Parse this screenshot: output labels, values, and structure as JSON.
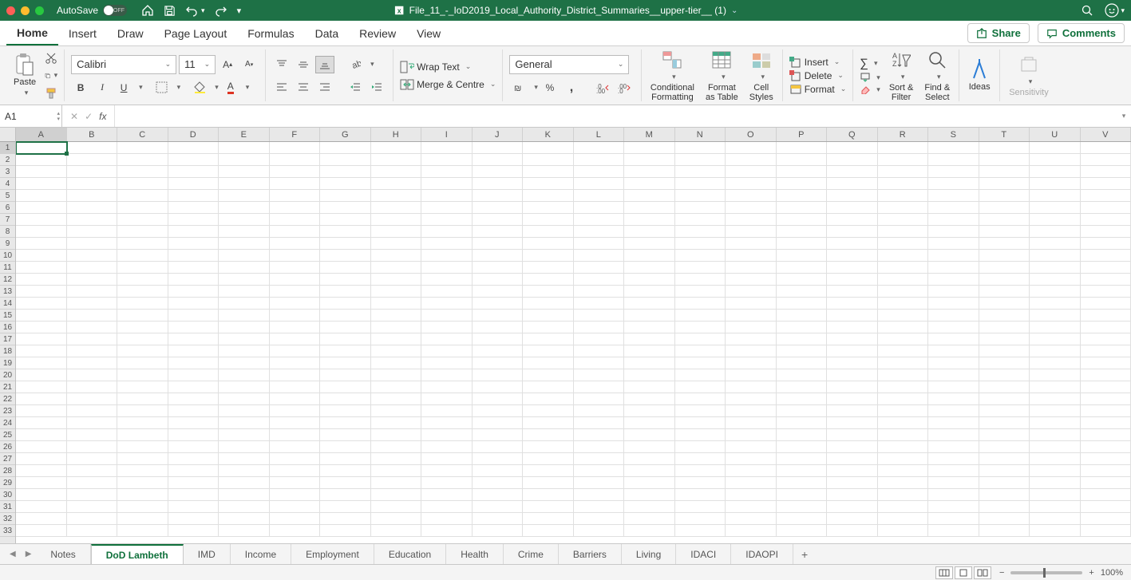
{
  "titlebar": {
    "autosave_label": "AutoSave",
    "autosave_state": "OFF",
    "filename": "File_11_-_IoD2019_Local_Authority_District_Summaries__upper-tier__ (1)"
  },
  "tabs": {
    "items": [
      "Home",
      "Insert",
      "Draw",
      "Page Layout",
      "Formulas",
      "Data",
      "Review",
      "View"
    ],
    "active": 0,
    "share": "Share",
    "comments": "Comments"
  },
  "ribbon": {
    "paste": "Paste",
    "font_name": "Calibri",
    "font_size": "11",
    "wrap": "Wrap Text",
    "merge": "Merge & Centre",
    "number_format": "General",
    "cond_fmt": "Conditional\nFormatting",
    "fmt_table": "Format\nas Table",
    "cell_styles": "Cell\nStyles",
    "insert": "Insert",
    "delete": "Delete",
    "format": "Format",
    "sort_filter": "Sort &\nFilter",
    "find_select": "Find &\nSelect",
    "ideas": "Ideas",
    "sensitivity": "Sensitivity"
  },
  "fx": {
    "namebox": "A1",
    "fx_label": "fx"
  },
  "grid": {
    "cols": [
      "A",
      "B",
      "C",
      "D",
      "E",
      "F",
      "G",
      "H",
      "I",
      "J",
      "K",
      "L",
      "M",
      "N",
      "O",
      "P",
      "Q",
      "R",
      "S",
      "T",
      "U",
      "V"
    ],
    "rows": 33,
    "active": "A1"
  },
  "sheets": {
    "items": [
      "Notes",
      "DoD Lambeth",
      "IMD",
      "Income",
      "Employment",
      "Education",
      "Health",
      "Crime",
      "Barriers",
      "Living",
      "IDACI",
      "IDAOPI"
    ],
    "active": 1
  },
  "status": {
    "zoom": "100%"
  }
}
